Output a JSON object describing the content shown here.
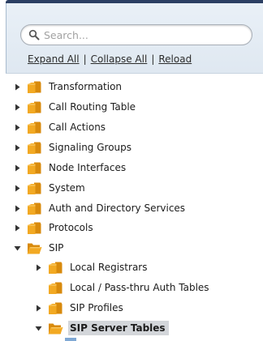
{
  "search": {
    "placeholder": "Search..."
  },
  "actions": {
    "expand_all": "Expand All",
    "collapse_all": "Collapse All",
    "reload": "Reload",
    "separator": "|"
  },
  "tree": {
    "items": [
      {
        "label": "Transformation",
        "expanded": false,
        "has_children": true
      },
      {
        "label": "Call Routing Table",
        "expanded": false,
        "has_children": true
      },
      {
        "label": "Call Actions",
        "expanded": false,
        "has_children": true
      },
      {
        "label": "Signaling Groups",
        "expanded": false,
        "has_children": true
      },
      {
        "label": "Node Interfaces",
        "expanded": false,
        "has_children": true
      },
      {
        "label": "System",
        "expanded": false,
        "has_children": true
      },
      {
        "label": "Auth and Directory Services",
        "expanded": false,
        "has_children": true
      },
      {
        "label": "Protocols",
        "expanded": false,
        "has_children": true
      },
      {
        "label": "SIP",
        "expanded": true,
        "has_children": true
      },
      {
        "label": "Local Registrars",
        "expanded": false,
        "has_children": true
      },
      {
        "label": "Local / Pass-thru Auth Tables",
        "expanded": false,
        "has_children": false
      },
      {
        "label": "SIP Profiles",
        "expanded": false,
        "has_children": true
      },
      {
        "label": "SIP Server Tables",
        "expanded": true,
        "has_children": true,
        "selected": true
      }
    ]
  },
  "colors": {
    "folder_fill": "#f2a923",
    "folder_dark": "#d88a0c",
    "selected_bg": "#d3d6da",
    "header_bg": "#e4ecf4",
    "top_bar": "#2b3f63"
  }
}
